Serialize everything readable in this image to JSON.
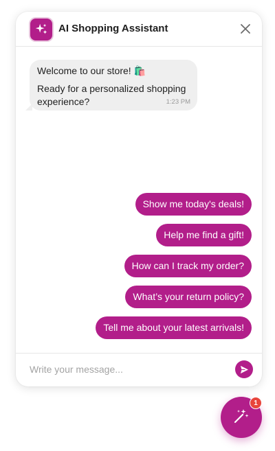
{
  "header": {
    "title": "AI Shopping Assistant",
    "logo_icon": "sparkles-icon",
    "close_icon": "close-icon"
  },
  "messages": [
    {
      "sender": "bot",
      "line1": "Welcome to our store! 🛍️",
      "line2": "Ready for a personalized shopping experience?",
      "time": "1:23 PM"
    }
  ],
  "suggestions": [
    "Show me today's deals!",
    "Help me find a gift!",
    "How can I track my order?",
    "What’s your return policy?",
    "Tell me about your latest arrivals!"
  ],
  "composer": {
    "placeholder": "Write your message...",
    "value": "",
    "send_icon": "send-icon"
  },
  "launcher": {
    "icon": "magic-wand-icon",
    "badge_count": "1"
  },
  "colors": {
    "accent": "#b21e8a",
    "badge": "#e8453c",
    "bubble": "#efefef"
  }
}
